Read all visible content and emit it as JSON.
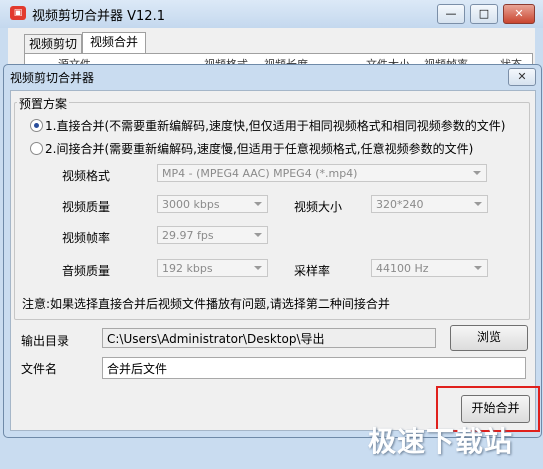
{
  "main_window": {
    "title": "视频剪切合并器 V12.1",
    "tabs": [
      {
        "label": "视频剪切"
      },
      {
        "label": "视频合并"
      }
    ],
    "columns": [
      "源文件",
      "视频格式",
      "视频长度",
      "文件大小",
      "视频帧率",
      "状态"
    ]
  },
  "dialog": {
    "title": "视频剪切合并器",
    "close_glyph": "✕",
    "preset": {
      "legend": "预置方案",
      "option_direct": "1.直接合并(不需要重新编解码,速度快,但仅适用于相同视频格式和相同视频参数的文件)",
      "option_indirect": "2.间接合并(需要重新编解码,速度慢,但适用于任意视频格式,任意视频参数的文件)",
      "selected": "direct",
      "fields": {
        "video_format_label": "视频格式",
        "video_format_value": "MP4 - (MPEG4 AAC) MPEG4 (*.mp4)",
        "video_quality_label": "视频质量",
        "video_quality_value": "3000 kbps",
        "video_size_label": "视频大小",
        "video_size_value": "320*240",
        "video_framerate_label": "视频帧率",
        "video_framerate_value": "29.97 fps",
        "audio_quality_label": "音频质量",
        "audio_quality_value": "192 kbps",
        "sample_rate_label": "采样率",
        "sample_rate_value": "44100 Hz"
      }
    },
    "note": "注意:如果选择直接合并后视频文件播放有问题,请选择第二种间接合并",
    "output_dir_label": "输出目录",
    "output_dir_value": "C:\\Users\\Administrator\\Desktop\\导出",
    "browse_label": "浏览",
    "filename_label": "文件名",
    "filename_value": "合并后文件",
    "start_label": "开始合并"
  },
  "watermark": "极速下载站",
  "colors": {
    "highlight": "#e0201c",
    "accent": "#2a4e9c"
  }
}
